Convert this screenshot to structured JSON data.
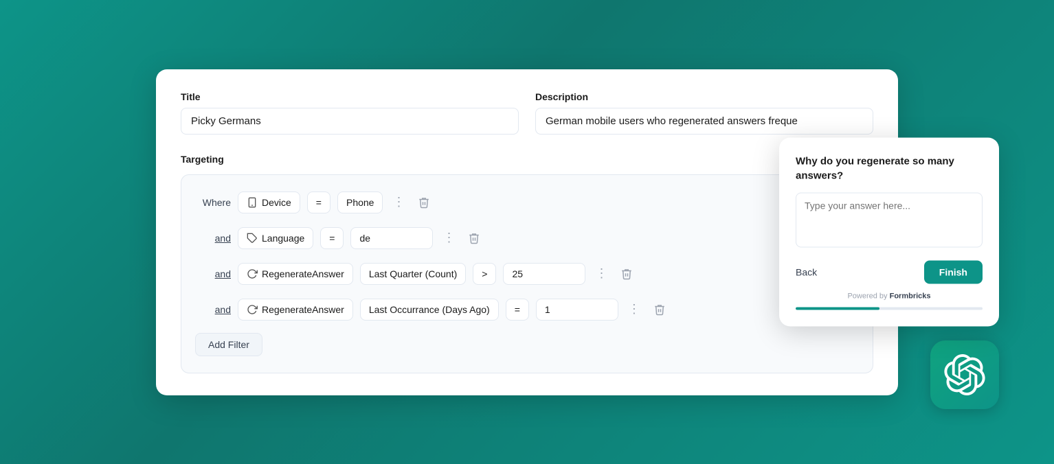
{
  "main_card": {
    "title_label": "Title",
    "title_value": "Picky Germans",
    "description_label": "Description",
    "description_value": "German mobile users who regenerated answers freque",
    "targeting_label": "Targeting",
    "filters": [
      {
        "prefix": "Where",
        "prefix_underline": false,
        "attribute": "Device",
        "operator": "=",
        "value": "Phone"
      },
      {
        "prefix": "and",
        "prefix_underline": true,
        "attribute": "Language",
        "operator": "=",
        "value": "de"
      },
      {
        "prefix": "and",
        "prefix_underline": true,
        "attribute": "RegenerateAnswer",
        "operator": ">",
        "value": "25",
        "extra": "Last Quarter (Count)"
      },
      {
        "prefix": "and",
        "prefix_underline": true,
        "attribute": "RegenerateAnswer",
        "operator": "=",
        "value": "1",
        "extra": "Last Occurrance (Days Ago)"
      }
    ],
    "add_filter_label": "Add Filter"
  },
  "preview_card": {
    "question": "Why do you regenerate so many answers?",
    "placeholder": "Type your answer here...",
    "back_label": "Back",
    "finish_label": "Finish",
    "powered_by_text": "Powered by",
    "powered_by_brand": "Formbricks",
    "progress_percent": 45
  }
}
